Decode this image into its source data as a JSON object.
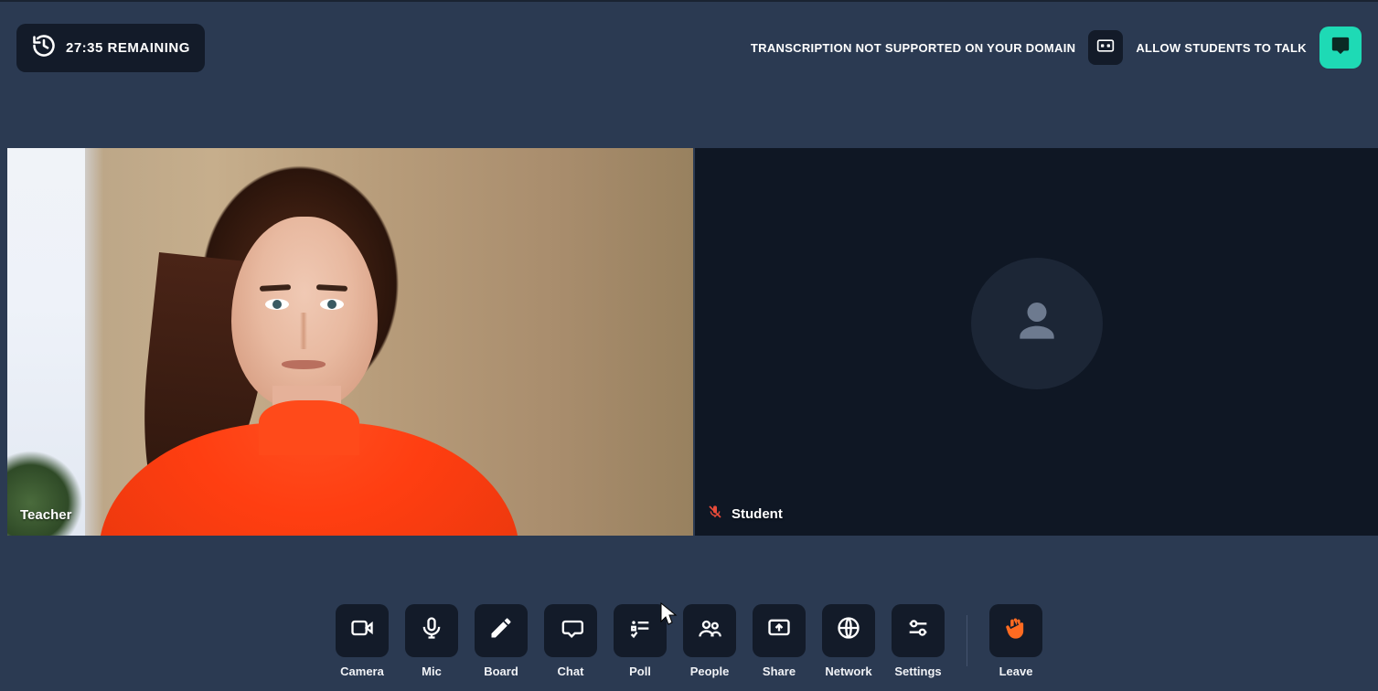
{
  "header": {
    "timer_text": "27:35 REMAINING",
    "transcription_text": "TRANSCRIPTION NOT SUPPORTED ON YOUR DOMAIN",
    "allow_text": "ALLOW STUDENTS TO TALK"
  },
  "tiles": {
    "teacher_label": "Teacher",
    "student_label": "Student"
  },
  "toolbar": {
    "camera": "Camera",
    "mic": "Mic",
    "board": "Board",
    "chat": "Chat",
    "poll": "Poll",
    "people": "People",
    "share": "Share",
    "network": "Network",
    "settings": "Settings",
    "leave": "Leave"
  },
  "colors": {
    "accent": "#1edab5",
    "orange": "#ff6b21",
    "red": "#e84b3a",
    "bg": "#2b3a52"
  }
}
